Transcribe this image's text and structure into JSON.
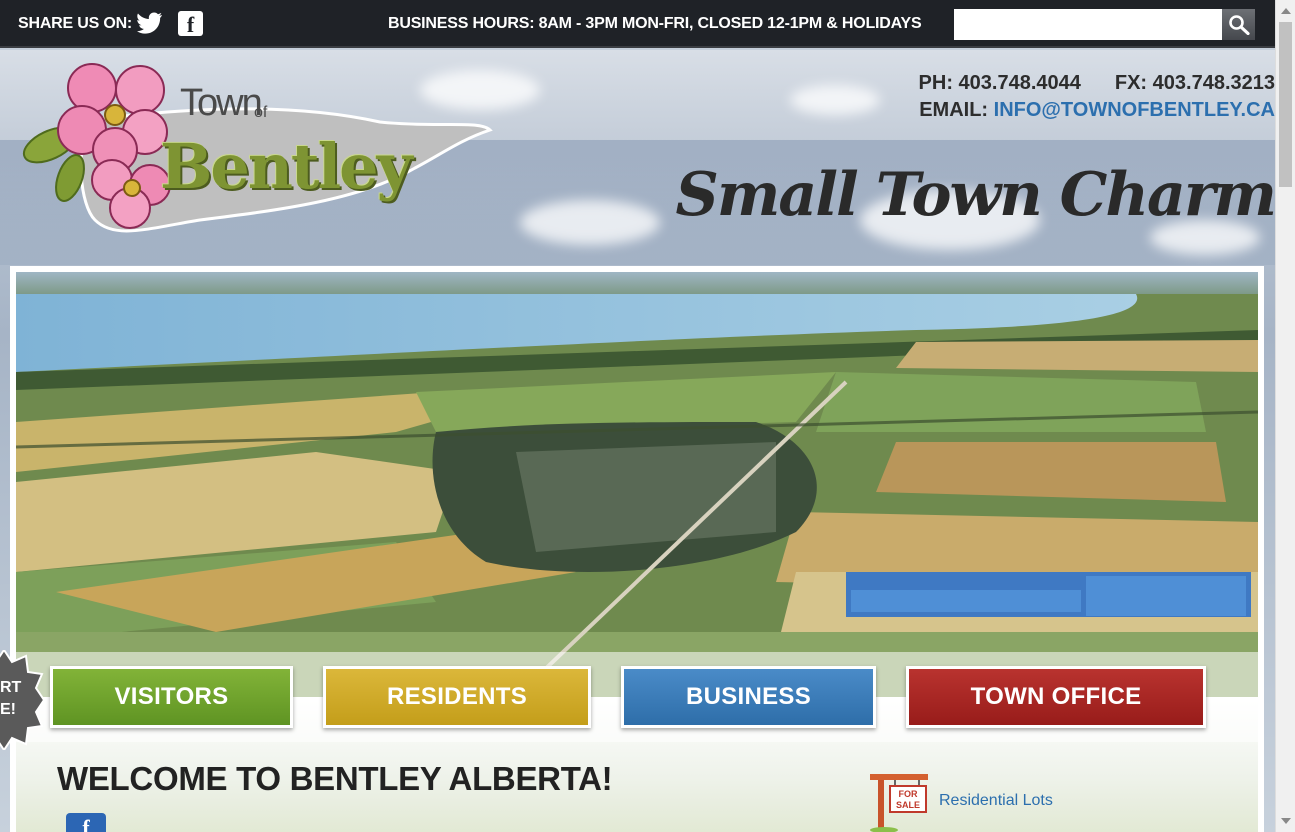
{
  "topbar": {
    "share_label": "SHARE US ON:",
    "social_icons": [
      "twitter-icon",
      "facebook-icon"
    ],
    "business_hours": "BUSINESS HOURS: 8AM - 3PM MON-FRI, CLOSED 12-1PM & HOLIDAYS",
    "search": {
      "value": "",
      "placeholder": "",
      "button_icon": "search-icon"
    }
  },
  "header": {
    "logo": {
      "town": "Town",
      "of": "of",
      "name": "Bentley"
    },
    "phone": "PH: 403.748.4044",
    "fax": "FX: 403.748.3213",
    "email_label": "EMAIL:",
    "email": "INFO@TOWNOFBENTLEY.CA",
    "tagline": "Small Town Charm"
  },
  "nav": {
    "items": [
      {
        "label": "VISITORS",
        "color": "#6fa52c"
      },
      {
        "label": "RESIDENTS",
        "color": "#cfa826"
      },
      {
        "label": "BUSINESS",
        "color": "#3a7cbb"
      },
      {
        "label": "TOWN OFFICE",
        "color": "#a82623"
      }
    ]
  },
  "badge": {
    "line1": "RT",
    "line2": "E!"
  },
  "main": {
    "welcome_title": "WELCOME TO BENTLEY ALBERTA!",
    "side_links": [
      {
        "label": "Residential Lots",
        "icon": "for-sale-sign-icon"
      }
    ],
    "facebook_icon": "facebook-icon"
  },
  "colors": {
    "topbar_bg": "#1f2227",
    "link": "#2c6fae",
    "logo_green": "#7e9433"
  }
}
